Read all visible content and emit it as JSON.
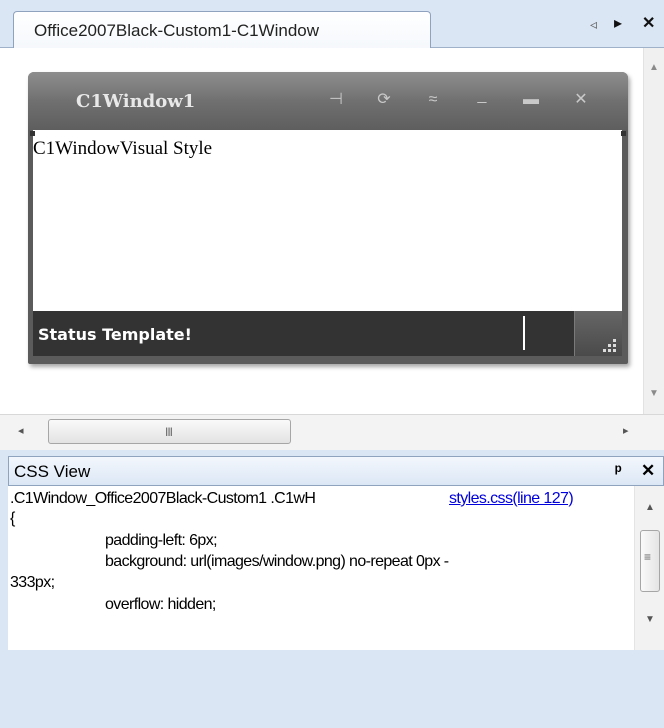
{
  "tab": {
    "title": "Office2007Black-Custom1-C1Window",
    "prev_icon": "◃",
    "next_icon": "▸",
    "close_icon": "✕"
  },
  "c1window": {
    "title": "C1Window1",
    "content_text": "C1WindowVisual Style",
    "status_text": "Status Template!",
    "buttons": [
      {
        "name": "pin-icon",
        "glyph": "⊣"
      },
      {
        "name": "reload-icon",
        "glyph": "⟳"
      },
      {
        "name": "collapse-icon",
        "glyph": "≈"
      },
      {
        "name": "minimize-icon",
        "glyph": "_"
      },
      {
        "name": "maximize-icon",
        "glyph": "▬"
      },
      {
        "name": "close-icon",
        "glyph": "✕"
      }
    ]
  },
  "hscroll": {
    "left_arrow": "◂",
    "right_arrow": "▸",
    "thumb_grip": "III"
  },
  "css_view": {
    "title": "CSS View",
    "pin_icon": "ᵼ",
    "close_icon": "✕",
    "selector": ".C1Window_Office2007Black-Custom1 .C1wH",
    "link": "styles.css(line 127)",
    "open_brace": "{",
    "lines": [
      "padding-left: 6px;",
      "background: url(images/window.png) no-repeat 0px -",
      "333px;",
      "overflow: hidden;"
    ]
  }
}
